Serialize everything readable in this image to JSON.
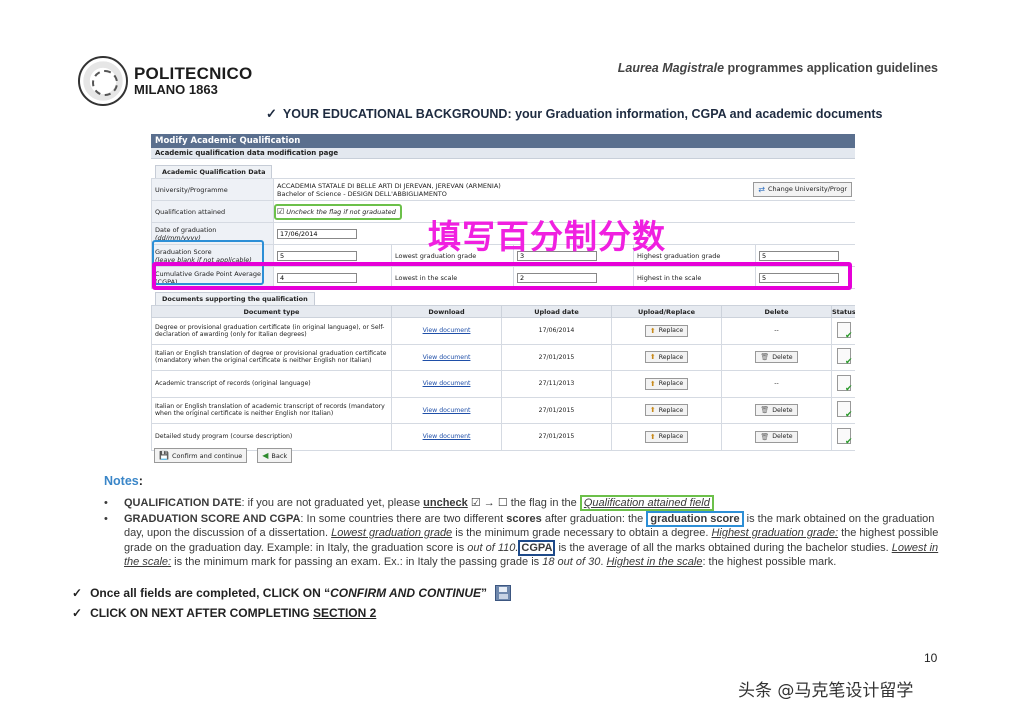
{
  "header": {
    "logo_line1": "POLITECNICO",
    "logo_line2": "MILANO 1863",
    "guideline_italic": "Laurea Magistrale",
    "guideline_rest": " programmes application guidelines",
    "section_check": "✓",
    "section_heading": "YOUR EDUCATIONAL BACKGROUND: your Graduation information, CGPA and academic documents"
  },
  "form": {
    "title": "Modify Academic Qualification",
    "subtitle": "Academic qualification data modification page",
    "data_tab": "Academic Qualification Data",
    "university_label": "University/Programme",
    "university_value_line1": "ACCADEMIA STATALE DI BELLE ARTI DI JEREVAN, JEREVAN (ARMENIA)",
    "university_value_line2": "Bachelor of Science - DESIGN DELL'ABBIGLIAMENTO",
    "change_button": "Change University/Progr",
    "qualification_label": "Qualification attained",
    "qualification_check_hint": "Uncheck the flag if not graduated",
    "date_label": "Date of graduation",
    "date_format": "(dd/mm/yyyy)",
    "date_value": "17/06/2014",
    "score_label": "Graduation Score",
    "score_hint": "(leave blank if not applicable)",
    "score_value": "5",
    "lowest_grad_label": "Lowest graduation grade",
    "lowest_grad_value": "3",
    "highest_grad_label": "Highest graduation grade",
    "highest_grad_value": "5",
    "cgpa_label_line1": "Cumulative Grade Point Average",
    "cgpa_label_line2": "(CGPA)",
    "cgpa_value": "4",
    "lowest_scale_label": "Lowest in the scale",
    "lowest_scale_value": "2",
    "highest_scale_label": "Highest in the scale",
    "highest_scale_value": "5",
    "docs_tab": "Documents supporting the qualification",
    "columns": [
      "Document type",
      "Download",
      "Upload date",
      "Upload/Replace",
      "Delete",
      "Status"
    ],
    "documents": [
      {
        "type": "Degree or provisional graduation certificate (in original language), or Self-declaration of awarding (only for Italian degrees)",
        "download": "View document",
        "date": "17/06/2014",
        "replace": "Replace",
        "delete": "--"
      },
      {
        "type": "Italian or English translation of degree or provisional graduation certificate (mandatory when the original certificate is neither English nor Italian)",
        "download": "View document",
        "date": "27/01/2015",
        "replace": "Replace",
        "delete": "Delete"
      },
      {
        "type": "Academic transcript of records (original language)",
        "download": "View document",
        "date": "27/11/2013",
        "replace": "Replace",
        "delete": "--"
      },
      {
        "type": "Italian or English translation of academic transcript of records (mandatory when the original certificate is neither English nor Italian)",
        "download": "View document",
        "date": "27/01/2015",
        "replace": "Replace",
        "delete": "Delete"
      },
      {
        "type": "Detailed study program (course description)",
        "download": "View document",
        "date": "27/01/2015",
        "replace": "Replace",
        "delete": "Delete"
      }
    ],
    "confirm_button": "Confirm and continue",
    "back_button": "Back"
  },
  "overlay_text": "填写百分制分数",
  "notes": {
    "title": "Notes",
    "title_colon": ":",
    "n1_bold": "QUALIFICATION DATE",
    "n1_a": ": if you are not graduated yet, please ",
    "n1_uncheck": "uncheck",
    "n1_b": " ☑ → ☐ the flag in the ",
    "n1_field": "Qualification attained field",
    "n2_bold": "GRADUATION SCORE AND CGPA",
    "n2_a": ": In some countries there are two different ",
    "n2_scores": "scores",
    "n2_b": " after graduation: the ",
    "n2_grad_score": "graduation score",
    "n2_c": " is the mark obtained on the graduation day, upon the discussion of a dissertation. ",
    "n2_lowest": "Lowest graduation grade",
    "n2_d": " is the minimum grade necessary to obtain a degree. ",
    "n2_highest": "Highest graduation grade:",
    "n2_e": " the highest possible grade on the graduation day. Example: in Italy, the graduation score is ",
    "n2_outof": "out of 110.",
    "n2_cgpa": "CGPA",
    "n2_f": " is the average of all the marks obtained during the bachelor studies. ",
    "n2_lowscale": "Lowest in the scale:",
    "n2_g": " is the minimum mark for passing an exam. Ex.: in Italy the passing grade is ",
    "n2_18": "18 out of 30",
    "n2_h": ". ",
    "n2_highscale": "Highest in the scale",
    "n2_i": ": the highest possible mark."
  },
  "steps": {
    "check": "✓",
    "s1_a": "Once all fields are completed, CLICK ON “",
    "s1_italic": "CONFIRM AND CONTINUE",
    "s1_b": "”",
    "s2_a": "CLICK ON NEXT AFTER COMPLETING ",
    "s2_section": "SECTION 2"
  },
  "page_number": "10",
  "watermark": "头条 @马克笔设计留学"
}
